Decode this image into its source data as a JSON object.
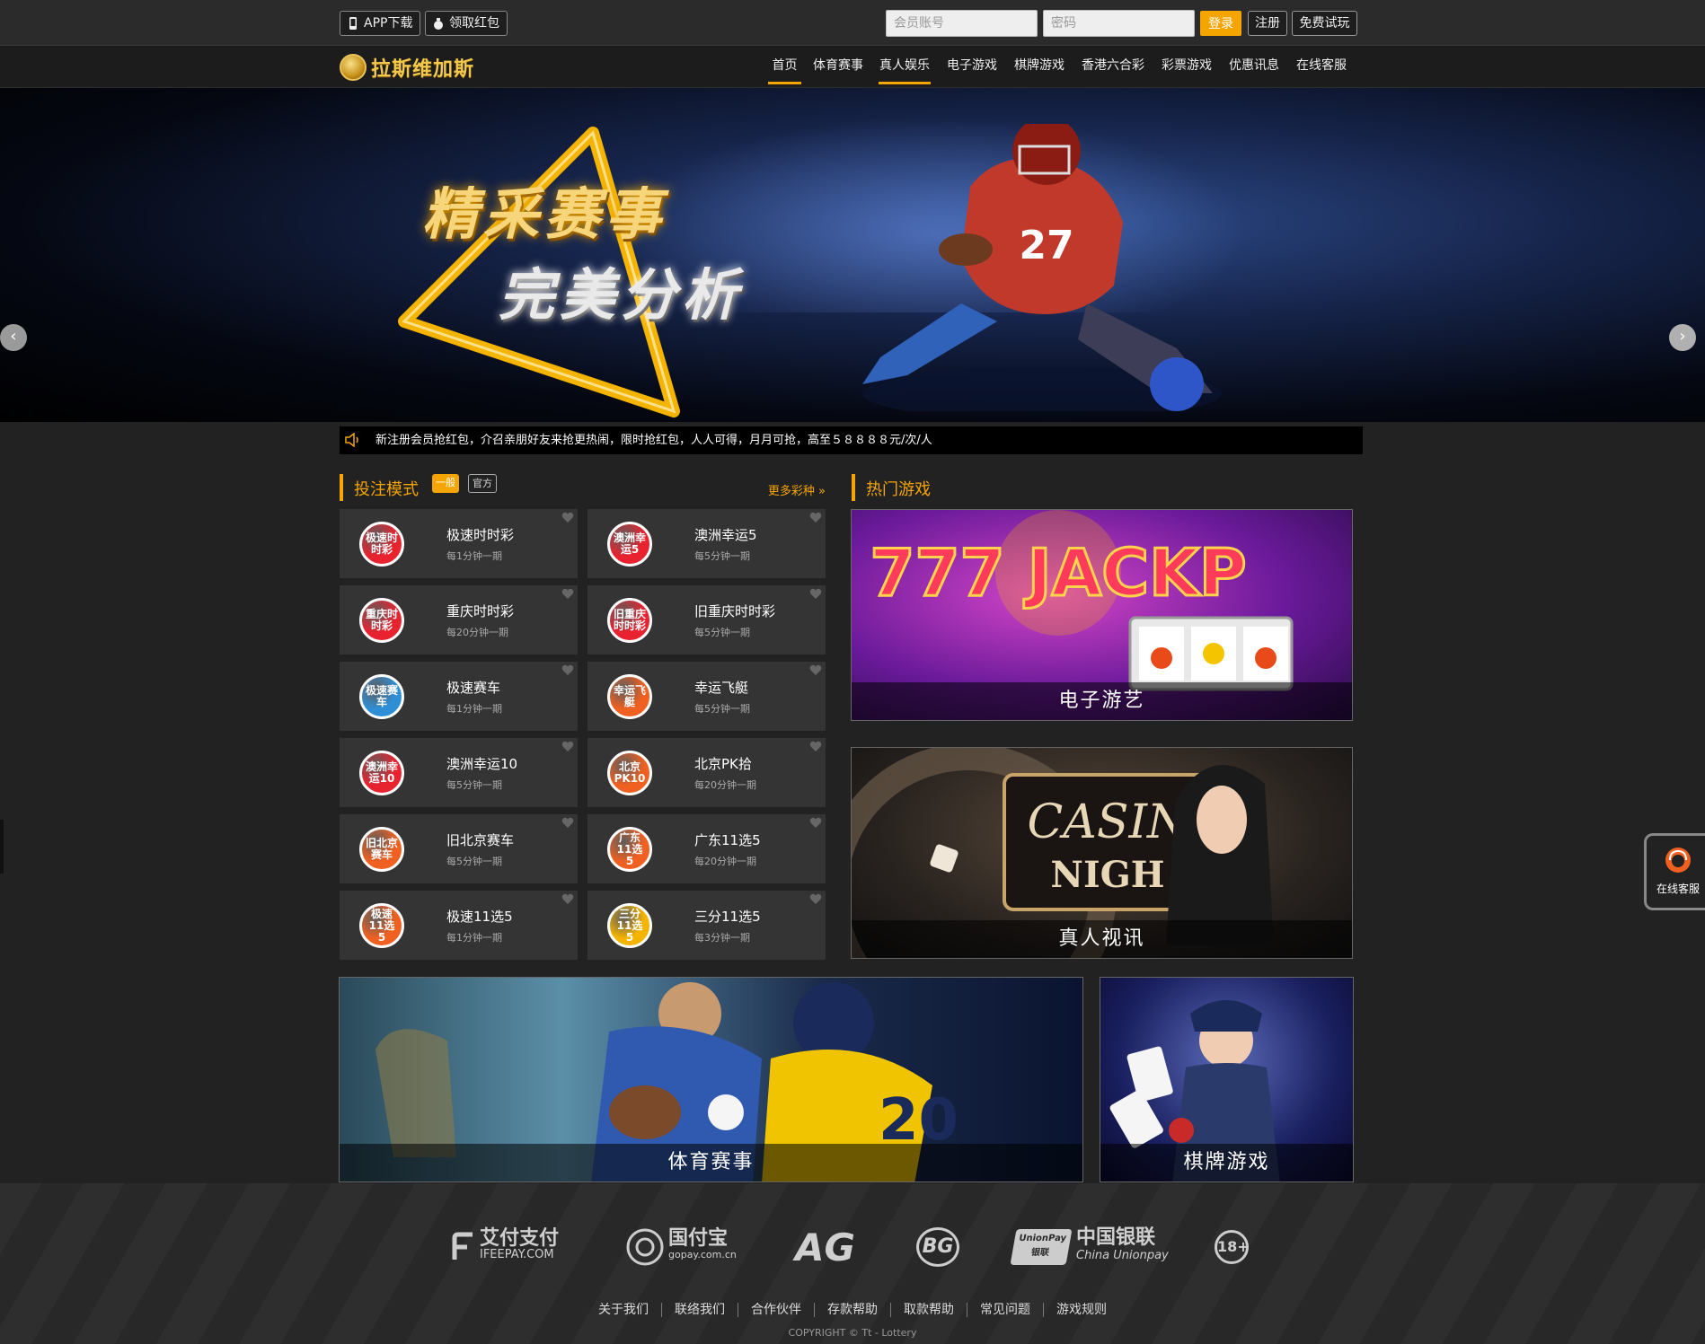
{
  "topbar": {
    "app_download": "APP下载",
    "red_packet": "领取红包",
    "account_placeholder": "会员账号",
    "password_placeholder": "密码",
    "login": "登录",
    "register": "注册",
    "free_trial": "免费试玩"
  },
  "brand": {
    "name": "拉斯维加斯"
  },
  "nav": {
    "items": [
      "首页",
      "体育赛事",
      "真人娱乐",
      "电子游戏",
      "棋牌游戏",
      "香港六合彩",
      "彩票游戏",
      "优惠讯息",
      "在线客服"
    ],
    "active": [
      "首页",
      "真人娱乐"
    ]
  },
  "banner": {
    "headline_1": "精采赛事",
    "headline_2": "完美分析",
    "prev_icon": "chevron-left-icon",
    "next_icon": "chevron-right-icon"
  },
  "marquee": {
    "text": "新注册会员抢红包，介召亲朋好友来抢更热闹，限时抢红包，人人可得，月月可抢，高至５８８８８元/次/人"
  },
  "betting": {
    "title": "投注模式",
    "mode_general": "一般",
    "mode_official": "官方",
    "more": "更多彩种",
    "games": [
      {
        "name": "极速时时彩",
        "period": "每1分钟一期",
        "badge": "极速时时彩",
        "color": "#e8222e"
      },
      {
        "name": "澳洲幸运5",
        "period": "每5分钟一期",
        "badge": "澳洲幸运5",
        "color": "#e8222e"
      },
      {
        "name": "重庆时时彩",
        "period": "每20分钟一期",
        "badge": "重庆时时彩",
        "color": "#e8222e"
      },
      {
        "name": "旧重庆时时彩",
        "period": "每5分钟一期",
        "badge": "旧重庆时时彩",
        "color": "#e8222e"
      },
      {
        "name": "极速赛车",
        "period": "每1分钟一期",
        "badge": "极速赛车",
        "color": "#2f8fd6"
      },
      {
        "name": "幸运飞艇",
        "period": "每5分钟一期",
        "badge": "幸运飞艇",
        "color": "#f06020"
      },
      {
        "name": "澳洲幸运10",
        "period": "每5分钟一期",
        "badge": "澳洲幸运10",
        "color": "#e8222e"
      },
      {
        "name": "北京PK拾",
        "period": "每20分钟一期",
        "badge": "北京PK10",
        "color": "#f06020"
      },
      {
        "name": "旧北京赛车",
        "period": "每5分钟一期",
        "badge": "旧北京赛车",
        "color": "#f06020"
      },
      {
        "name": "广东11选5",
        "period": "每20分钟一期",
        "badge": "广东11选5",
        "color": "#f06020"
      },
      {
        "name": "极速11选5",
        "period": "每1分钟一期",
        "badge": "极速11选5",
        "color": "#f06020"
      },
      {
        "name": "三分11选5",
        "period": "每3分钟一期",
        "badge": "三分11选5",
        "color": "#f5b400"
      }
    ]
  },
  "hot": {
    "title": "热门游戏",
    "tiles": {
      "slots": "电子游艺",
      "live": "真人视讯",
      "sports": "体育赛事",
      "cards": "棋牌游戏"
    },
    "slots_art": "777 JACKP",
    "live_art_1": "CASIN",
    "live_art_2": "NIGH"
  },
  "footer": {
    "partners": [
      "艾付支付",
      "IFEEPAY.COM",
      "国付宝",
      "gopay.com.cn",
      "AG",
      "BG",
      "UnionPay",
      "银联",
      "中国银联",
      "China Unionpay",
      "18+"
    ],
    "links": [
      "关于我们",
      "联络我们",
      "合作伙伴",
      "存款帮助",
      "取款帮助",
      "常见问题",
      "游戏规则"
    ],
    "copyright": "COPYRIGHT © Tt - Lottery"
  },
  "side_service": {
    "label": "在线客服",
    "icon": "headset-icon"
  },
  "colors": {
    "accent": "#f5a500",
    "bg": "#222222",
    "card": "#343434"
  }
}
